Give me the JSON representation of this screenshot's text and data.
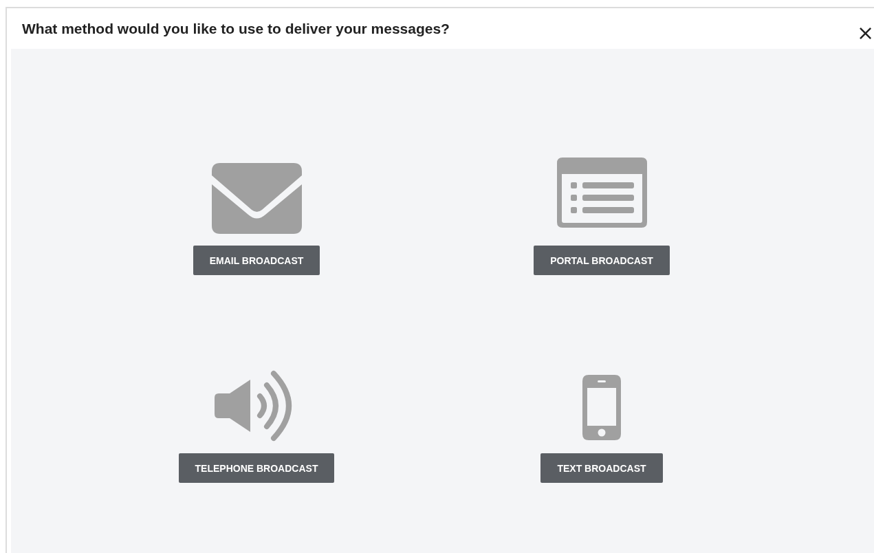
{
  "dialog": {
    "title": "What method would you like to use to deliver your messages?",
    "close": "×"
  },
  "options": [
    {
      "kind": "email",
      "label": "EMAIL BROADCAST"
    },
    {
      "kind": "portal",
      "label": "PORTAL BROADCAST"
    },
    {
      "kind": "telephone",
      "label": "TELEPHONE BROADCAST"
    },
    {
      "kind": "text",
      "label": "TEXT BROADCAST"
    }
  ]
}
